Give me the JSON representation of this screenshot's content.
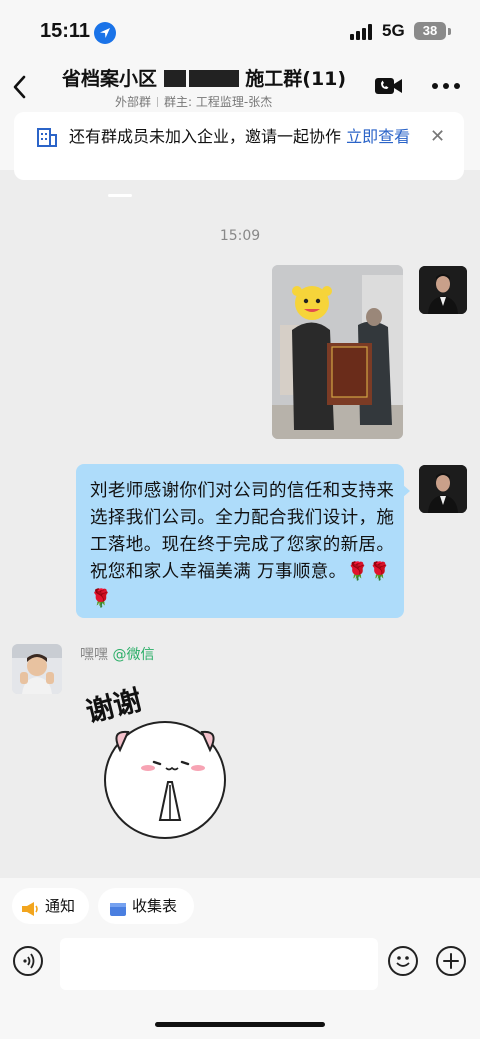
{
  "status_bar": {
    "time": "15:11",
    "network": "5G",
    "battery": "38",
    "icons": [
      "location-arrow-icon",
      "signal-icon",
      "battery-icon"
    ]
  },
  "header": {
    "title_prefix": "省档案小区",
    "title_suffix": "施工群(11)",
    "tag": "外部群",
    "owner": "群主: 工程监理-张杰",
    "icons": [
      "back-chevron-icon",
      "video-call-icon",
      "more-icon"
    ]
  },
  "banner": {
    "text": "还有群成员未加入企业，邀请一起协作 ",
    "link": "立即查看",
    "icons": [
      "building-icon",
      "close-icon"
    ]
  },
  "chat": {
    "timestamp": "15:09",
    "messages": [
      {
        "from": "me",
        "type": "image"
      },
      {
        "from": "me",
        "type": "text",
        "text": "刘老师感谢你们对公司的信任和支持来选择我们公司。全力配合我们设计，施工落地。现在终于完成了您家的新居。祝您和家人幸福美满  万事顺意。🌹🌹🌹"
      },
      {
        "from": "other",
        "type": "sticker"
      }
    ],
    "other_sender": {
      "name": "嘿嘿",
      "platform": "@微信"
    },
    "sticker_text": "谢谢"
  },
  "bottom": {
    "chips": [
      "通知",
      "收集表"
    ],
    "input_placeholder": "",
    "icons": [
      "voice-icon",
      "emoji-icon",
      "plus-icon"
    ]
  },
  "colors": {
    "bubble": "#aedcfa",
    "link": "#2b64c8",
    "wechat_green": "#2aae67",
    "background": "#ededed"
  }
}
